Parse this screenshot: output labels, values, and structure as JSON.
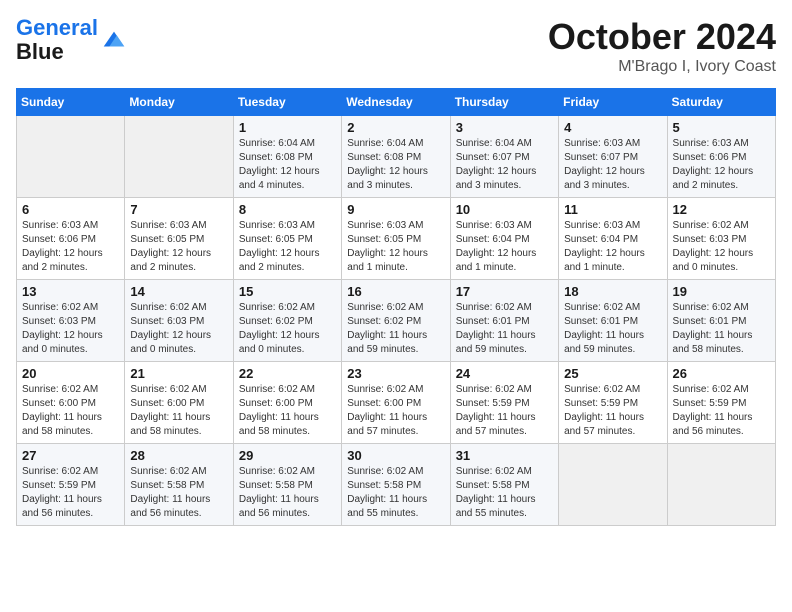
{
  "header": {
    "logo_line1": "General",
    "logo_line2": "Blue",
    "title": "October 2024",
    "subtitle": "M'Brago I, Ivory Coast"
  },
  "weekdays": [
    "Sunday",
    "Monday",
    "Tuesday",
    "Wednesday",
    "Thursday",
    "Friday",
    "Saturday"
  ],
  "weeks": [
    [
      {
        "day": "",
        "info": ""
      },
      {
        "day": "",
        "info": ""
      },
      {
        "day": "1",
        "info": "Sunrise: 6:04 AM\nSunset: 6:08 PM\nDaylight: 12 hours and 4 minutes."
      },
      {
        "day": "2",
        "info": "Sunrise: 6:04 AM\nSunset: 6:08 PM\nDaylight: 12 hours and 3 minutes."
      },
      {
        "day": "3",
        "info": "Sunrise: 6:04 AM\nSunset: 6:07 PM\nDaylight: 12 hours and 3 minutes."
      },
      {
        "day": "4",
        "info": "Sunrise: 6:03 AM\nSunset: 6:07 PM\nDaylight: 12 hours and 3 minutes."
      },
      {
        "day": "5",
        "info": "Sunrise: 6:03 AM\nSunset: 6:06 PM\nDaylight: 12 hours and 2 minutes."
      }
    ],
    [
      {
        "day": "6",
        "info": "Sunrise: 6:03 AM\nSunset: 6:06 PM\nDaylight: 12 hours and 2 minutes."
      },
      {
        "day": "7",
        "info": "Sunrise: 6:03 AM\nSunset: 6:05 PM\nDaylight: 12 hours and 2 minutes."
      },
      {
        "day": "8",
        "info": "Sunrise: 6:03 AM\nSunset: 6:05 PM\nDaylight: 12 hours and 2 minutes."
      },
      {
        "day": "9",
        "info": "Sunrise: 6:03 AM\nSunset: 6:05 PM\nDaylight: 12 hours and 1 minute."
      },
      {
        "day": "10",
        "info": "Sunrise: 6:03 AM\nSunset: 6:04 PM\nDaylight: 12 hours and 1 minute."
      },
      {
        "day": "11",
        "info": "Sunrise: 6:03 AM\nSunset: 6:04 PM\nDaylight: 12 hours and 1 minute."
      },
      {
        "day": "12",
        "info": "Sunrise: 6:02 AM\nSunset: 6:03 PM\nDaylight: 12 hours and 0 minutes."
      }
    ],
    [
      {
        "day": "13",
        "info": "Sunrise: 6:02 AM\nSunset: 6:03 PM\nDaylight: 12 hours and 0 minutes."
      },
      {
        "day": "14",
        "info": "Sunrise: 6:02 AM\nSunset: 6:03 PM\nDaylight: 12 hours and 0 minutes."
      },
      {
        "day": "15",
        "info": "Sunrise: 6:02 AM\nSunset: 6:02 PM\nDaylight: 12 hours and 0 minutes."
      },
      {
        "day": "16",
        "info": "Sunrise: 6:02 AM\nSunset: 6:02 PM\nDaylight: 11 hours and 59 minutes."
      },
      {
        "day": "17",
        "info": "Sunrise: 6:02 AM\nSunset: 6:01 PM\nDaylight: 11 hours and 59 minutes."
      },
      {
        "day": "18",
        "info": "Sunrise: 6:02 AM\nSunset: 6:01 PM\nDaylight: 11 hours and 59 minutes."
      },
      {
        "day": "19",
        "info": "Sunrise: 6:02 AM\nSunset: 6:01 PM\nDaylight: 11 hours and 58 minutes."
      }
    ],
    [
      {
        "day": "20",
        "info": "Sunrise: 6:02 AM\nSunset: 6:00 PM\nDaylight: 11 hours and 58 minutes."
      },
      {
        "day": "21",
        "info": "Sunrise: 6:02 AM\nSunset: 6:00 PM\nDaylight: 11 hours and 58 minutes."
      },
      {
        "day": "22",
        "info": "Sunrise: 6:02 AM\nSunset: 6:00 PM\nDaylight: 11 hours and 58 minutes."
      },
      {
        "day": "23",
        "info": "Sunrise: 6:02 AM\nSunset: 6:00 PM\nDaylight: 11 hours and 57 minutes."
      },
      {
        "day": "24",
        "info": "Sunrise: 6:02 AM\nSunset: 5:59 PM\nDaylight: 11 hours and 57 minutes."
      },
      {
        "day": "25",
        "info": "Sunrise: 6:02 AM\nSunset: 5:59 PM\nDaylight: 11 hours and 57 minutes."
      },
      {
        "day": "26",
        "info": "Sunrise: 6:02 AM\nSunset: 5:59 PM\nDaylight: 11 hours and 56 minutes."
      }
    ],
    [
      {
        "day": "27",
        "info": "Sunrise: 6:02 AM\nSunset: 5:59 PM\nDaylight: 11 hours and 56 minutes."
      },
      {
        "day": "28",
        "info": "Sunrise: 6:02 AM\nSunset: 5:58 PM\nDaylight: 11 hours and 56 minutes."
      },
      {
        "day": "29",
        "info": "Sunrise: 6:02 AM\nSunset: 5:58 PM\nDaylight: 11 hours and 56 minutes."
      },
      {
        "day": "30",
        "info": "Sunrise: 6:02 AM\nSunset: 5:58 PM\nDaylight: 11 hours and 55 minutes."
      },
      {
        "day": "31",
        "info": "Sunrise: 6:02 AM\nSunset: 5:58 PM\nDaylight: 11 hours and 55 minutes."
      },
      {
        "day": "",
        "info": ""
      },
      {
        "day": "",
        "info": ""
      }
    ]
  ]
}
